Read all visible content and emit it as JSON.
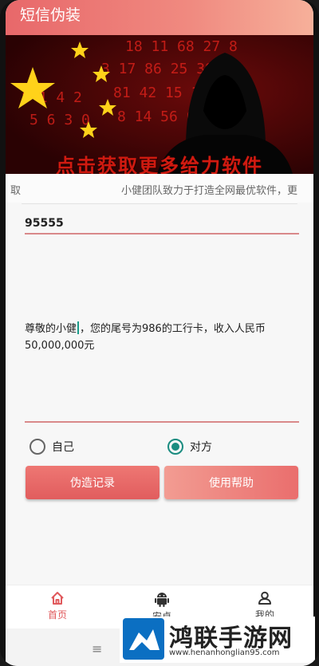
{
  "app": {
    "title": "短信伪装"
  },
  "banner": {
    "caption": "点击获取更多给力软件",
    "digits": [
      "18 11 68 27 8",
      "3 17 86 25 38 8",
      "81 42 15 16 27",
      "8 14 56 09 15"
    ]
  },
  "marquee": {
    "left_fragment": "取",
    "text": "小健团队致力于打造全网最优软件，更"
  },
  "form": {
    "phone_value": "95555",
    "message_before_caret": "尊敬的小健",
    "message_after_caret": "，您的尾号为986的工行卡，收入人民币50,000,000元"
  },
  "sender_options": [
    {
      "label": "自己",
      "selected": false
    },
    {
      "label": "对方",
      "selected": true
    }
  ],
  "buttons": {
    "records": "伪造记录",
    "help": "使用帮助"
  },
  "tabs": [
    {
      "label": "首页",
      "icon": "home-icon",
      "active": true
    },
    {
      "label": "安卓",
      "icon": "android-icon",
      "active": false
    },
    {
      "label": "我的",
      "icon": "user-icon",
      "active": false
    }
  ],
  "watermark": {
    "title": "鸿联手游网",
    "url": "www.henanhonglian95.com"
  },
  "colors": {
    "accent": "#e0595c",
    "radio": "#1a8c80",
    "underline": "#d9898a"
  }
}
